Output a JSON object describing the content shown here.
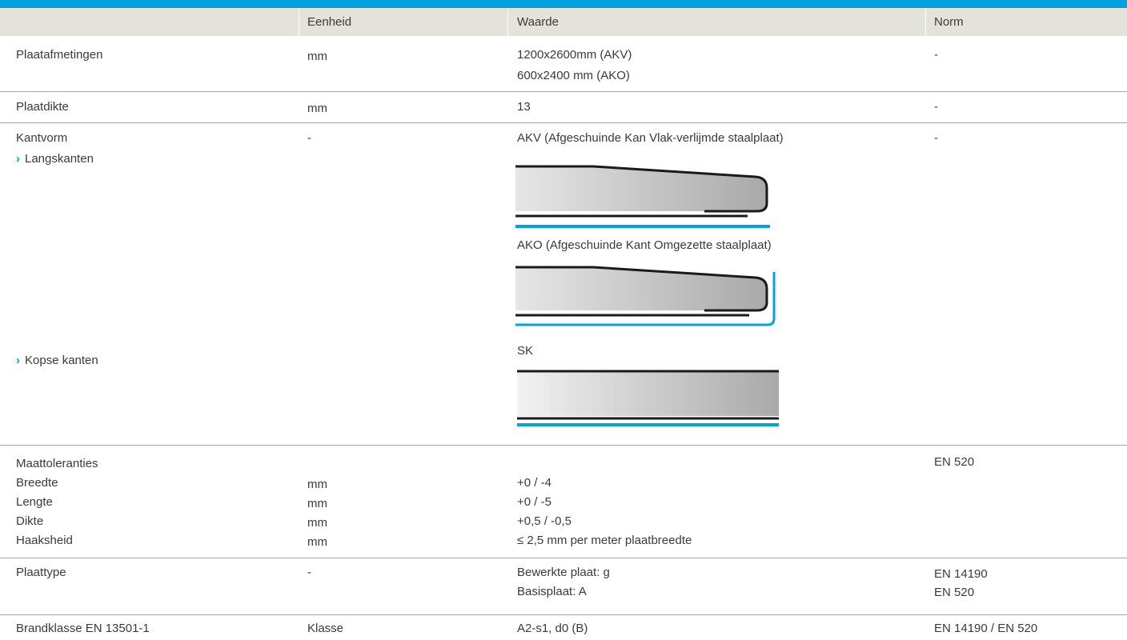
{
  "header": {
    "col1": "",
    "col2": "Eenheid",
    "col3": "Waarde",
    "col4": "Norm"
  },
  "rows": {
    "plaatafmetingen": {
      "label": "Plaatafmetingen",
      "unit": "mm",
      "value_1": "1200x2600mm (AKV)",
      "value_2": "600x2400 mm (AKO)",
      "norm": "-"
    },
    "plaatdikte": {
      "label": "Plaatdikte",
      "unit": "mm",
      "value": "13",
      "norm": "-"
    },
    "kantvorm": {
      "label": "Kantvorm",
      "sub_langs": "Langskanten",
      "sub_kops": "Kopse kanten",
      "unit": "-",
      "norm": "-",
      "akv": "AKV (Afgeschuinde Kan Vlak-verlijmde staalplaat)",
      "ako": "AKO (Afgeschuinde Kant Omgezette staalplaat)",
      "sk": "SK"
    },
    "maattoleranties": {
      "label": "Maattoleranties",
      "norm": "EN 520",
      "items": [
        {
          "label": "Breedte",
          "unit": "mm",
          "value": "+0 / -4"
        },
        {
          "label": "Lengte",
          "unit": "mm",
          "value": "+0 / -5"
        },
        {
          "label": "Dikte",
          "unit": "mm",
          "value": "+0,5 / -0,5"
        },
        {
          "label": "Haaksheid",
          "unit": "mm",
          "value": "≤ 2,5 mm per meter plaatbreedte"
        }
      ]
    },
    "plaattype": {
      "label": "Plaattype",
      "unit": "-",
      "value_1": "Bewerkte plaat: g",
      "value_2": "Basisplaat: A",
      "norm_1": "EN 14190",
      "norm_2": "EN 520"
    },
    "brandklasse": {
      "label": "Brandklasse EN 13501-1",
      "unit": "Klasse",
      "value": "A2-s1, d0 (B)",
      "norm": "EN 14190 / EN 520"
    }
  },
  "colors": {
    "accent": "#00a3e0",
    "header_bg": "#e3e2db",
    "divider": "#a7a7a7",
    "text": "#3a3a3a"
  }
}
